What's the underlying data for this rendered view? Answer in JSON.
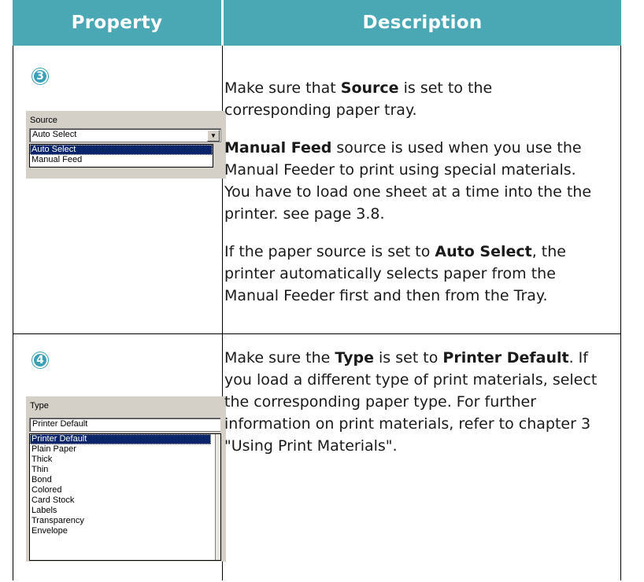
{
  "header": {
    "property": "Property",
    "description": "Description"
  },
  "rows": [
    {
      "number": "3",
      "panel": {
        "label": "Source",
        "selected_value": "Auto Select",
        "options": [
          "Auto Select",
          "Manual Feed"
        ]
      },
      "paragraphs": [
        {
          "pre": "Make sure that ",
          "bold": "Source",
          "post": " is set to the corresponding paper tray."
        },
        {
          "pre": "",
          "bold": "Manual Feed",
          "post": " source is used when you use the Manual Feeder to print using special materials. You have to load one sheet at a time into the the printer. see page 3.8."
        },
        {
          "pre": "If the paper source is set to ",
          "bold": "Auto Select",
          "post": ", the printer automatically selects paper from the Manual Feeder first and then from the Tray."
        }
      ]
    },
    {
      "number": "4",
      "panel": {
        "label": "Type",
        "selected_value": "Printer Default",
        "options": [
          "Printer Default",
          "Plain Paper",
          "Thick",
          "Thin",
          "Bond",
          "Colored",
          "Card Stock",
          "Labels",
          "Transparency",
          "Envelope"
        ]
      },
      "paragraph": {
        "pre": "Make sure the ",
        "bold1": "Type",
        "mid": " is set to ",
        "bold2": "Printer Default",
        "post": ". If you load a different type of print materials, select the corresponding paper type. For further information on print materials, refer to chapter 3 \"Using Print Materials\"."
      }
    }
  ],
  "colors": {
    "header_bg": "#4aa7b4",
    "header_text": "#ffffff",
    "badge": "#3aa0b5",
    "selection": "#0a246a"
  }
}
